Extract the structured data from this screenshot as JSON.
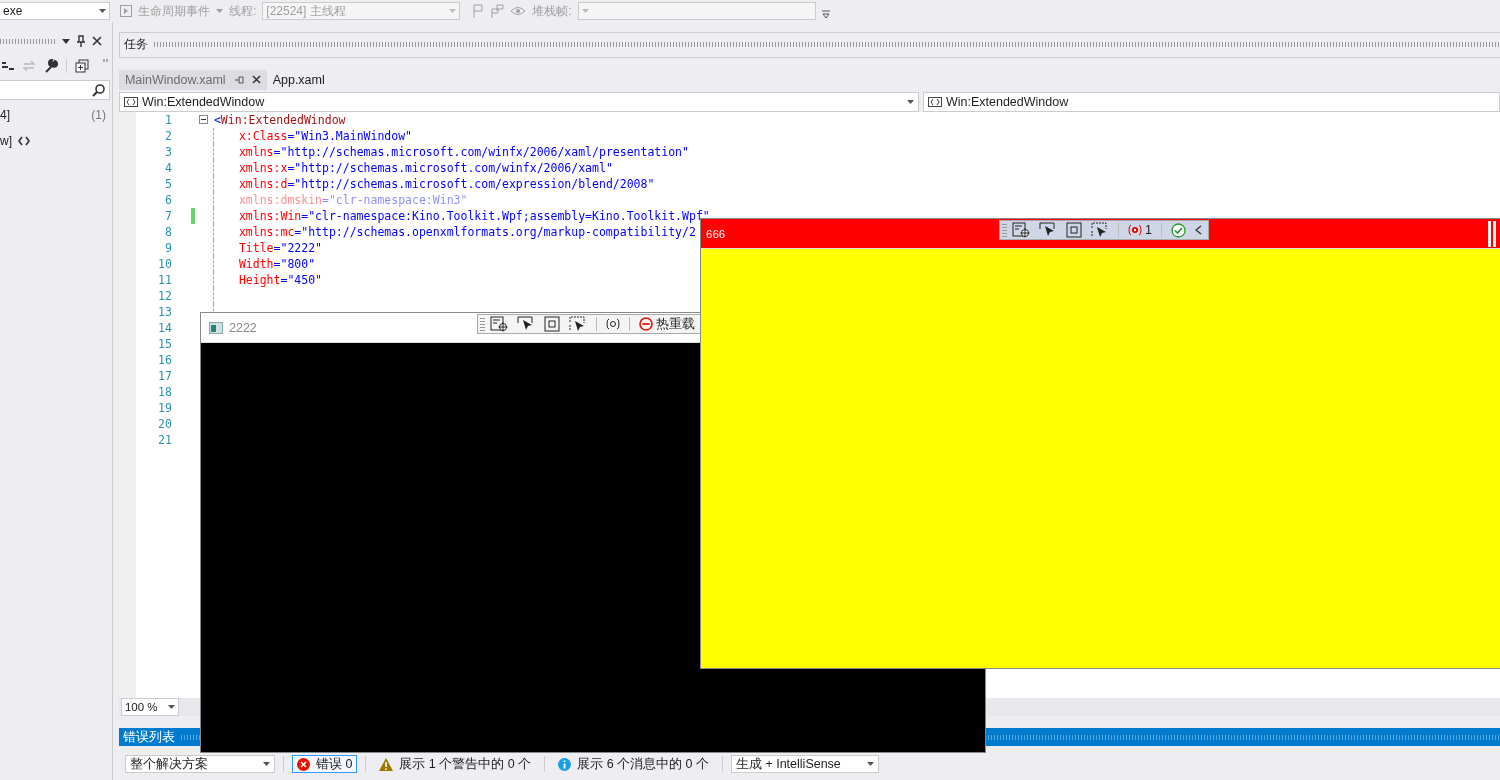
{
  "toolbar": {
    "disabled": true,
    "process_combo": "exe",
    "lifecycle_events": "生命周期事件",
    "thread_label": "线程:",
    "thread_combo": "[22524] 主线程",
    "stack_frame_label": "堆栈帧:"
  },
  "side_panel": {
    "items": [
      {
        "text": "4]",
        "count": "(1)"
      },
      {
        "text": "w]"
      }
    ]
  },
  "tasks_panel": {
    "title": "任务"
  },
  "tabs": [
    {
      "label": "MainWindow.xaml",
      "selected": true
    },
    {
      "label": "App.xaml",
      "selected": false
    }
  ],
  "navigation": {
    "type_combo": "Win:ExtendedWindow",
    "member_combo": "Win:ExtendedWindow"
  },
  "editor": {
    "lines": [
      {
        "number": "1",
        "collapsible": true,
        "tokens": [
          {
            "kind": "punct",
            "text": "<"
          },
          {
            "kind": "tag",
            "text": "Win:ExtendedWindow"
          }
        ]
      },
      {
        "number": "2",
        "tokens": [
          {
            "kind": "attr",
            "text": "x:Class"
          },
          {
            "kind": "value",
            "text": "=\"Win3.MainWindow\""
          }
        ]
      },
      {
        "number": "3",
        "tokens": [
          {
            "kind": "attr",
            "text": "xmlns"
          },
          {
            "kind": "value",
            "text": "=\"http://schemas.microsoft.com/winfx/2006/xaml/presentation\""
          }
        ]
      },
      {
        "number": "4",
        "tokens": [
          {
            "kind": "attr",
            "text": "xmlns:x"
          },
          {
            "kind": "value",
            "text": "=\"http://schemas.microsoft.com/winfx/2006/xaml\""
          }
        ]
      },
      {
        "number": "5",
        "tokens": [
          {
            "kind": "attr",
            "text": "xmlns:d"
          },
          {
            "kind": "value",
            "text": "=\"http://schemas.microsoft.com/expression/blend/2008\""
          }
        ]
      },
      {
        "number": "6",
        "faded": true,
        "tokens": [
          {
            "kind": "attr",
            "text": "xmlns:dmskin"
          },
          {
            "kind": "value",
            "text": "=\"clr-namespace:Win3\""
          }
        ]
      },
      {
        "number": "7",
        "changed": true,
        "tokens": [
          {
            "kind": "attr",
            "text": "xmlns:Win"
          },
          {
            "kind": "value",
            "text": "=\"clr-namespace:Kino.Toolkit.Wpf;assembly=Kino.Toolkit.Wpf\""
          }
        ]
      },
      {
        "number": "8",
        "tokens": [
          {
            "kind": "attr",
            "text": "xmlns:mc"
          },
          {
            "kind": "value",
            "text": "=\"http://schemas.openxmlformats.org/markup-compatibility/2"
          }
        ]
      },
      {
        "number": "9",
        "tokens": [
          {
            "kind": "attr",
            "text": "Title"
          },
          {
            "kind": "value",
            "text": "=\"2222\""
          }
        ]
      },
      {
        "number": "10",
        "tokens": [
          {
            "kind": "attr",
            "text": "Width"
          },
          {
            "kind": "value",
            "text": "=\"800\""
          }
        ]
      },
      {
        "number": "11",
        "tokens": [
          {
            "kind": "attr",
            "text": "Height"
          },
          {
            "kind": "value",
            "text": "=\"450\""
          }
        ]
      },
      {
        "number": "12"
      },
      {
        "number": "13"
      },
      {
        "number": "14"
      },
      {
        "number": "15"
      },
      {
        "number": "16"
      },
      {
        "number": "17"
      },
      {
        "number": "18"
      },
      {
        "number": "19"
      },
      {
        "number": "20"
      },
      {
        "number": "21"
      }
    ]
  },
  "zoom": "100 %",
  "error_list": {
    "title": "错误列表",
    "scope": "整个解决方案",
    "errors_button": {
      "label": "错误 0",
      "selected": true
    },
    "warnings_button": "展示 1 个警告中的 0 个",
    "messages_button": "展示 6 个消息中的 0 个",
    "source_combo": "生成 + IntelliSense"
  },
  "preview_windows": [
    {
      "kind": "light",
      "title": "2222",
      "toolbar": {
        "hot_reload_button": "热重载"
      }
    },
    {
      "kind": "red",
      "title": "666",
      "toolbar": {
        "issue_count": "1"
      }
    }
  ]
}
